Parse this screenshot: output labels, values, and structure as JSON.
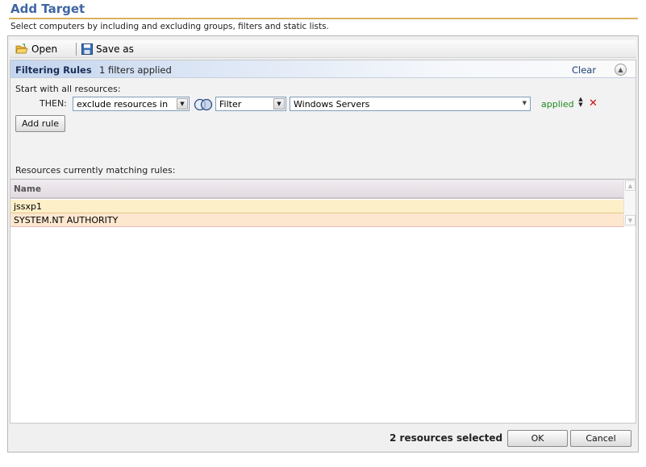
{
  "dialog": {
    "title": "Add Target",
    "subtitle": "Select computers by including and excluding groups, filters and static lists."
  },
  "toolbar": {
    "open_label": "Open",
    "save_as_label": "Save as"
  },
  "rules": {
    "header_title": "Filtering Rules",
    "filters_applied": "1 filters applied",
    "clear_label": "Clear",
    "start_text": "Start with all resources:",
    "rule": {
      "then_label": "THEN:",
      "action_value": "exclude resources in",
      "type_value": "Filter",
      "target_value": "Windows Servers",
      "status": "applied"
    },
    "add_rule_label": "Add rule"
  },
  "results": {
    "label": "Resources currently matching rules:",
    "column_header": "Name",
    "rows": [
      "jssxp1",
      "SYSTEM.NT AUTHORITY"
    ]
  },
  "footer": {
    "selected_text": "2 resources selected",
    "ok_label": "OK",
    "cancel_label": "Cancel"
  },
  "colors": {
    "title": "#3f66a2",
    "title_rule": "#d9b25c",
    "applied_status": "#1f8a1f",
    "remove_icon": "#d01010",
    "row1_background": "#fdefc8",
    "row2_background": "#fde7cf"
  }
}
